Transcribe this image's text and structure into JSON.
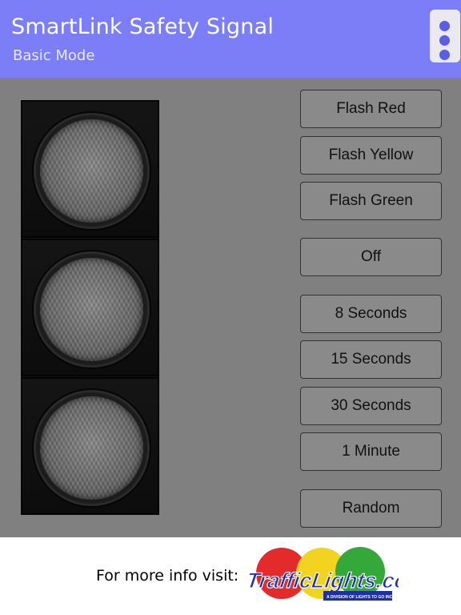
{
  "header": {
    "title": "SmartLink Safety Signal",
    "subtitle": "Basic Mode",
    "menu_icon": "more-vertical-icon"
  },
  "signal": {
    "lights": [
      {
        "name": "red-lamp",
        "state": "off"
      },
      {
        "name": "yellow-lamp",
        "state": "off"
      },
      {
        "name": "green-lamp",
        "state": "off"
      }
    ]
  },
  "controls": {
    "flash_red": "Flash Red",
    "flash_yellow": "Flash Yellow",
    "flash_green": "Flash Green",
    "off": "Off",
    "sec8": "8 Seconds",
    "sec15": "15 Seconds",
    "sec30": "30 Seconds",
    "min1": "1 Minute",
    "random": "Random"
  },
  "footer": {
    "text": "For more info visit:",
    "logo_text": "TrafficLights.com",
    "logo_tagline": "A DIVISION OF LIGHTS TO GO INC."
  },
  "colors": {
    "header_bg": "#7b7ef7",
    "menu_dot": "#5a5de8",
    "content_bg": "#808080",
    "button_bg": "#8a8a8a",
    "logo_red": "#e32b2b",
    "logo_yellow": "#f2d320",
    "logo_green": "#35a83a",
    "logo_blue": "#1e2fa0"
  }
}
